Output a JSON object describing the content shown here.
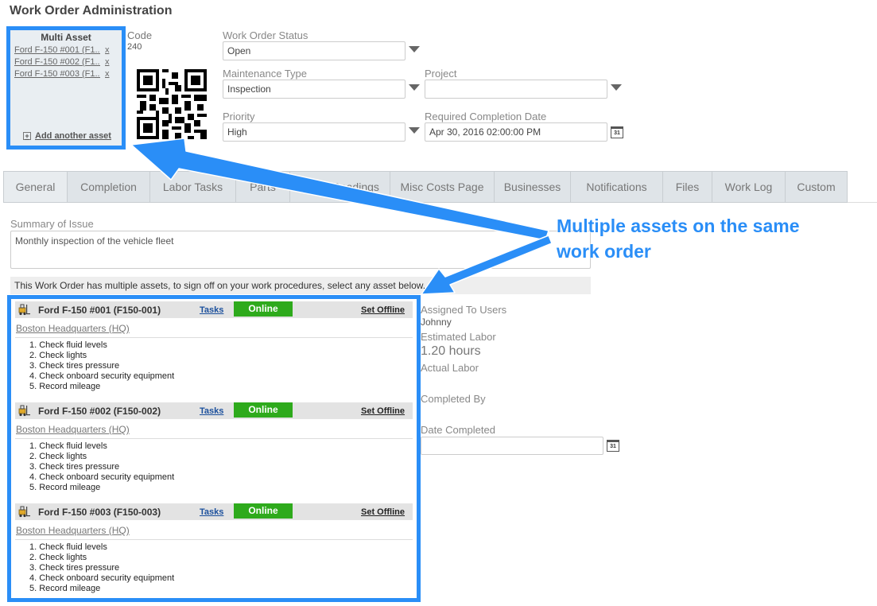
{
  "page": {
    "title": "Work Order Administration"
  },
  "multi_asset": {
    "title": "Multi Asset",
    "items": [
      {
        "label": "Ford F-150 #001 (F1...",
        "remove": "x"
      },
      {
        "label": "Ford F-150 #002 (F1...",
        "remove": "x"
      },
      {
        "label": "Ford F-150 #003 (F1...",
        "remove": "x"
      }
    ],
    "add_label": "Add another asset",
    "add_icon": "add-asset-icon"
  },
  "code": {
    "label": "Code",
    "value": "240"
  },
  "fields": {
    "status": {
      "label": "Work Order Status",
      "value": "Open"
    },
    "maintenance_type": {
      "label": "Maintenance Type",
      "value": "Inspection"
    },
    "project": {
      "label": "Project",
      "value": ""
    },
    "priority": {
      "label": "Priority",
      "value": "High"
    },
    "required_completion": {
      "label": "Required Completion Date",
      "value": "Apr 30, 2016 02:00:00 PM"
    },
    "calendar_icon_text": "31"
  },
  "tabs": [
    {
      "label": "General",
      "active": true
    },
    {
      "label": "Completion"
    },
    {
      "label": "Labor Tasks"
    },
    {
      "label": "Parts"
    },
    {
      "label": "Meter Readings"
    },
    {
      "label": "Misc Costs Page"
    },
    {
      "label": "Businesses"
    },
    {
      "label": "Notifications"
    },
    {
      "label": "Files"
    },
    {
      "label": "Work Log"
    },
    {
      "label": "Custom"
    }
  ],
  "summary": {
    "label": "Summary of Issue",
    "value": "Monthly inspection of the vehicle fleet"
  },
  "note": "This Work Order has multiple assets, to sign off on your work procedures, select any asset below.",
  "assets": [
    {
      "name": "Ford F-150 #001 (F150-001)",
      "tasks_label": "Tasks",
      "status": "Online",
      "offline_label": "Set Offline",
      "location": "Boston Headquarters (HQ)",
      "tasks": [
        "1. Check fluid levels",
        "2. Check lights",
        "3. Check tires pressure",
        "4. Check onboard security equipment",
        "5. Record mileage"
      ]
    },
    {
      "name": "Ford F-150 #002 (F150-002)",
      "tasks_label": "Tasks",
      "status": "Online",
      "offline_label": "Set Offline",
      "location": "Boston Headquarters (HQ)",
      "tasks": [
        "1. Check fluid levels",
        "2. Check lights",
        "3. Check tires pressure",
        "4. Check onboard security equipment",
        "5. Record mileage"
      ]
    },
    {
      "name": "Ford F-150 #003 (F150-003)",
      "tasks_label": "Tasks",
      "status": "Online",
      "offline_label": "Set Offline",
      "location": "Boston Headquarters (HQ)",
      "tasks": [
        "1. Check fluid levels",
        "2. Check lights",
        "3. Check tires pressure",
        "4. Check onboard security equipment",
        "5. Record mileage"
      ]
    }
  ],
  "right": {
    "assigned_label": "Assigned To Users",
    "assigned_value": "Johnny",
    "est_labor_label": "Estimated Labor",
    "est_labor_value": "1.20 hours",
    "actual_labor_label": "Actual Labor",
    "completed_by_label": "Completed By",
    "date_completed_label": "Date Completed"
  },
  "callout": {
    "line1": "Multiple assets on the same",
    "line2": "work order"
  },
  "colors": {
    "accent": "#2a8ef7",
    "online": "#2eaa1c",
    "tab_bg": "#dfe4e8"
  }
}
